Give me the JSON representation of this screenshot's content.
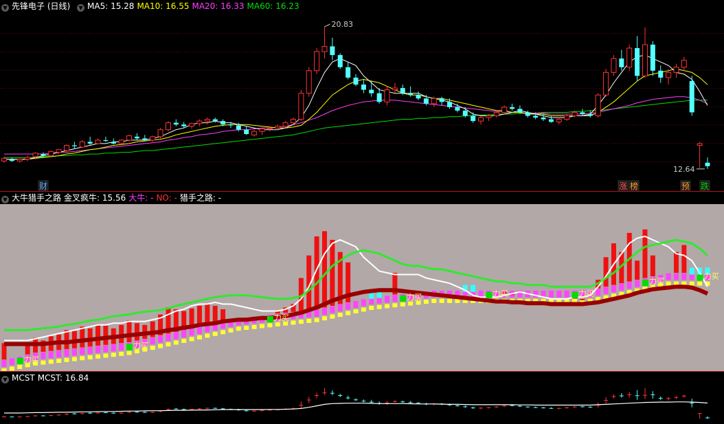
{
  "panels": {
    "main": {
      "title": "先锋电子 (日线)",
      "ma": [
        {
          "label": "MA5: 15.28",
          "color": "#ffffff"
        },
        {
          "label": "MA10: 16.55",
          "color": "#ffff00"
        },
        {
          "label": "MA20: 16.33",
          "color": "#ff40ff"
        },
        {
          "label": "MA60: 16.23",
          "color": "#00e000"
        }
      ],
      "high_label": "20.83",
      "low_label": "12.64",
      "markers": [
        {
          "text": "财",
          "color": "#5fa8ff"
        },
        {
          "text": "涨",
          "color": "#ff5050"
        },
        {
          "text": "榜",
          "color": "#ff9a2e"
        },
        {
          "text": "预",
          "color": "#ff9a2e"
        },
        {
          "text": "跌",
          "color": "#00d000"
        }
      ]
    },
    "indicator": {
      "title": "大牛猎手之路",
      "fields": [
        {
          "label": "金叉疯牛: 15.56",
          "color": "#ffffff"
        },
        {
          "label": "大牛: -",
          "color": "#ff40ff"
        },
        {
          "label": "NO: -",
          "color": "#ff3030"
        },
        {
          "label": "猎手之路: -",
          "color": "#ffffff"
        }
      ],
      "buy_label": "力买"
    },
    "mcst": {
      "title": "MCST",
      "field": "MCST: 16.84"
    }
  },
  "colors": {
    "up": "#ff3333",
    "down": "#54ffff",
    "bg_mid": "#b2a8a8"
  },
  "chart_data": [
    {
      "type": "candlestick",
      "title": "先锋电子 (日线)",
      "ylim": [
        12.0,
        21.5
      ],
      "high": 20.83,
      "low": 12.64,
      "candles": [
        [
          13.1,
          13.35,
          13.0,
          13.25
        ],
        [
          13.2,
          13.3,
          13.05,
          13.1
        ],
        [
          13.1,
          13.25,
          13.0,
          13.2
        ],
        [
          13.2,
          13.4,
          13.1,
          13.3
        ],
        [
          13.35,
          13.6,
          13.2,
          13.55
        ],
        [
          13.5,
          13.6,
          13.3,
          13.4
        ],
        [
          13.4,
          13.7,
          13.35,
          13.65
        ],
        [
          13.6,
          13.8,
          13.5,
          13.75
        ],
        [
          13.7,
          14.05,
          13.6,
          14.0
        ],
        [
          14.0,
          14.2,
          13.8,
          13.95
        ],
        [
          13.9,
          14.3,
          13.85,
          14.2
        ],
        [
          14.2,
          14.5,
          14.0,
          14.1
        ],
        [
          14.1,
          14.4,
          14.05,
          14.3
        ],
        [
          14.3,
          14.5,
          14.2,
          14.25
        ],
        [
          14.2,
          14.4,
          14.05,
          14.1
        ],
        [
          14.1,
          14.35,
          14.0,
          14.3
        ],
        [
          14.3,
          14.6,
          14.2,
          14.55
        ],
        [
          14.5,
          14.7,
          14.3,
          14.4
        ],
        [
          14.4,
          14.6,
          14.25,
          14.3
        ],
        [
          14.3,
          14.55,
          14.2,
          14.5
        ],
        [
          14.5,
          15.0,
          14.4,
          14.9
        ],
        [
          14.9,
          15.4,
          14.8,
          15.3
        ],
        [
          15.3,
          15.5,
          15.1,
          15.2
        ],
        [
          15.2,
          15.35,
          15.0,
          15.1
        ],
        [
          15.1,
          15.3,
          14.95,
          15.25
        ],
        [
          15.25,
          15.5,
          15.1,
          15.4
        ],
        [
          15.4,
          15.6,
          15.2,
          15.5
        ],
        [
          15.5,
          15.6,
          15.3,
          15.4
        ],
        [
          15.4,
          15.5,
          15.1,
          15.2
        ],
        [
          15.2,
          15.35,
          15.0,
          15.15
        ],
        [
          15.15,
          15.3,
          14.8,
          14.9
        ],
        [
          14.9,
          15.1,
          14.6,
          14.65
        ],
        [
          14.6,
          14.9,
          14.5,
          14.8
        ],
        [
          14.8,
          15.0,
          14.6,
          14.95
        ],
        [
          14.95,
          15.1,
          14.8,
          15.0
        ],
        [
          15.0,
          15.2,
          14.9,
          15.1
        ],
        [
          15.1,
          15.4,
          15.0,
          15.3
        ],
        [
          15.3,
          15.6,
          15.2,
          15.5
        ],
        [
          15.5,
          17.2,
          15.4,
          17.0
        ],
        [
          17.0,
          18.5,
          16.8,
          18.3
        ],
        [
          18.3,
          19.6,
          18.1,
          19.4
        ],
        [
          19.4,
          20.83,
          19.0,
          19.7
        ],
        [
          19.7,
          20.2,
          18.9,
          19.2
        ],
        [
          19.2,
          19.3,
          18.4,
          18.5
        ],
        [
          18.5,
          18.8,
          17.8,
          17.9
        ],
        [
          17.9,
          18.1,
          17.4,
          17.5
        ],
        [
          17.5,
          17.8,
          17.0,
          17.2
        ],
        [
          17.2,
          17.7,
          16.8,
          17.0
        ],
        [
          17.0,
          17.3,
          16.4,
          16.5
        ],
        [
          16.5,
          17.4,
          16.3,
          17.2
        ],
        [
          17.2,
          17.6,
          17.0,
          17.3
        ],
        [
          17.3,
          17.5,
          16.9,
          17.0
        ],
        [
          17.0,
          17.4,
          16.8,
          16.9
        ],
        [
          16.9,
          17.1,
          16.6,
          16.7
        ],
        [
          16.7,
          16.9,
          16.3,
          16.4
        ],
        [
          16.4,
          16.8,
          16.2,
          16.7
        ],
        [
          16.7,
          16.8,
          16.3,
          16.5
        ],
        [
          16.5,
          16.7,
          16.1,
          16.2
        ],
        [
          16.2,
          16.4,
          15.9,
          16.0
        ],
        [
          16.0,
          16.2,
          15.6,
          15.7
        ],
        [
          15.7,
          15.9,
          15.3,
          15.4
        ],
        [
          15.4,
          15.7,
          15.2,
          15.6
        ],
        [
          15.6,
          15.8,
          15.4,
          15.7
        ],
        [
          15.7,
          16.0,
          15.6,
          15.9
        ],
        [
          15.9,
          16.3,
          15.8,
          16.2
        ],
        [
          16.2,
          16.4,
          16.0,
          16.1
        ],
        [
          16.1,
          16.3,
          15.8,
          15.9
        ],
        [
          15.9,
          16.0,
          15.6,
          15.7
        ],
        [
          15.7,
          15.9,
          15.5,
          15.6
        ],
        [
          15.6,
          15.8,
          15.4,
          15.5
        ],
        [
          15.5,
          15.7,
          15.3,
          15.35
        ],
        [
          15.35,
          15.6,
          15.2,
          15.5
        ],
        [
          15.5,
          15.8,
          15.4,
          15.7
        ],
        [
          15.7,
          16.0,
          15.6,
          15.9
        ],
        [
          15.9,
          16.1,
          15.7,
          15.8
        ],
        [
          15.8,
          16.0,
          15.6,
          15.7
        ],
        [
          15.7,
          17.0,
          15.6,
          16.9
        ],
        [
          16.9,
          18.4,
          16.8,
          18.2
        ],
        [
          18.2,
          19.2,
          18.0,
          19.0
        ],
        [
          19.0,
          19.5,
          18.3,
          18.5
        ],
        [
          18.5,
          19.8,
          18.3,
          19.6
        ],
        [
          19.6,
          20.3,
          17.7,
          18.0
        ],
        [
          18.0,
          20.8,
          17.9,
          19.8
        ],
        [
          19.8,
          20.0,
          18.0,
          18.3
        ],
        [
          18.3,
          18.6,
          17.6,
          17.9
        ],
        [
          17.9,
          18.4,
          17.5,
          18.2
        ],
        [
          18.2,
          18.7,
          17.9,
          18.5
        ],
        [
          18.5,
          19.1,
          18.3,
          18.9
        ],
        [
          17.7,
          18.0,
          15.7,
          15.9
        ],
        [
          14.0,
          14.2,
          12.7,
          14.1
        ],
        [
          13.0,
          13.3,
          12.64,
          12.8
        ]
      ],
      "ma5": [
        13.2,
        13.2,
        13.2,
        13.2,
        13.3,
        13.4,
        13.5,
        13.6,
        13.7,
        13.8,
        13.9,
        14.0,
        14.1,
        14.1,
        14.2,
        14.2,
        14.3,
        14.3,
        14.3,
        14.4,
        14.5,
        14.7,
        14.9,
        15.0,
        15.2,
        15.3,
        15.3,
        15.4,
        15.3,
        15.3,
        15.2,
        15.1,
        15.0,
        14.9,
        14.9,
        14.9,
        15.0,
        15.2,
        15.6,
        16.3,
        17.3,
        18.2,
        18.8,
        19.0,
        18.8,
        18.6,
        18.0,
        17.6,
        17.2,
        17.1,
        17.0,
        17.0,
        17.0,
        17.0,
        16.8,
        16.7,
        16.6,
        16.5,
        16.3,
        16.1,
        15.8,
        15.7,
        15.7,
        15.7,
        15.8,
        15.9,
        16.0,
        15.9,
        15.8,
        15.7,
        15.6,
        15.6,
        15.6,
        15.7,
        15.7,
        15.8,
        16.3,
        16.9,
        17.6,
        18.2,
        18.8,
        19.1,
        19.2,
        19.0,
        18.8,
        18.6,
        18.2,
        18.1,
        17.8,
        17.1,
        16.3
      ],
      "ma10": [
        13.2,
        13.2,
        13.2,
        13.2,
        13.25,
        13.3,
        13.35,
        13.4,
        13.5,
        13.55,
        13.65,
        13.75,
        13.8,
        13.9,
        14.0,
        14.05,
        14.1,
        14.2,
        14.25,
        14.3,
        14.35,
        14.45,
        14.6,
        14.7,
        14.8,
        14.9,
        15.0,
        15.1,
        15.15,
        15.2,
        15.2,
        15.2,
        15.15,
        15.1,
        15.05,
        15.0,
        15.0,
        15.05,
        15.15,
        15.5,
        15.9,
        16.4,
        16.9,
        17.2,
        17.5,
        17.7,
        17.8,
        17.7,
        17.6,
        17.4,
        17.2,
        17.0,
        16.9,
        16.9,
        16.8,
        16.7,
        16.7,
        16.6,
        16.5,
        16.4,
        16.3,
        16.2,
        16.1,
        16.0,
        16.0,
        15.9,
        15.9,
        15.8,
        15.8,
        15.8,
        15.7,
        15.7,
        15.7,
        15.7,
        15.7,
        15.7,
        15.9,
        16.2,
        16.5,
        16.9,
        17.3,
        17.7,
        18.0,
        18.1,
        18.2,
        18.3,
        18.4,
        18.3,
        18.2,
        17.9,
        17.5
      ],
      "ma20": [
        13.5,
        13.5,
        13.5,
        13.5,
        13.5,
        13.5,
        13.55,
        13.6,
        13.6,
        13.65,
        13.7,
        13.75,
        13.8,
        13.85,
        13.9,
        13.95,
        14.0,
        14.05,
        14.1,
        14.15,
        14.2,
        14.3,
        14.35,
        14.45,
        14.5,
        14.6,
        14.65,
        14.7,
        14.8,
        14.85,
        14.9,
        14.9,
        14.95,
        15.0,
        15.0,
        15.05,
        15.1,
        15.2,
        15.3,
        15.45,
        15.6,
        15.8,
        16.0,
        16.15,
        16.3,
        16.4,
        16.5,
        16.55,
        16.6,
        16.6,
        16.6,
        16.55,
        16.5,
        16.45,
        16.4,
        16.35,
        16.3,
        16.25,
        16.2,
        16.15,
        16.1,
        16.05,
        16.0,
        15.95,
        15.95,
        15.9,
        15.9,
        15.85,
        15.85,
        15.85,
        15.8,
        15.8,
        15.8,
        15.8,
        15.8,
        15.85,
        15.9,
        16.0,
        16.1,
        16.2,
        16.3,
        16.45,
        16.55,
        16.65,
        16.7,
        16.75,
        16.8,
        16.8,
        16.75,
        16.6,
        16.4
      ],
      "ma60": [
        13.3,
        13.3,
        13.3,
        13.3,
        13.3,
        13.35,
        13.35,
        13.4,
        13.4,
        13.45,
        13.45,
        13.5,
        13.5,
        13.55,
        13.55,
        13.6,
        13.6,
        13.65,
        13.7,
        13.7,
        13.75,
        13.8,
        13.85,
        13.9,
        13.95,
        14.0,
        14.05,
        14.1,
        14.15,
        14.2,
        14.25,
        14.3,
        14.35,
        14.4,
        14.45,
        14.5,
        14.55,
        14.6,
        14.7,
        14.8,
        14.9,
        15.0,
        15.05,
        15.1,
        15.15,
        15.2,
        15.25,
        15.3,
        15.35,
        15.4,
        15.45,
        15.5,
        15.5,
        15.55,
        15.55,
        15.6,
        15.6,
        15.65,
        15.65,
        15.7,
        15.7,
        15.75,
        15.75,
        15.8,
        15.8,
        15.8,
        15.85,
        15.85,
        15.85,
        15.9,
        15.9,
        15.9,
        15.9,
        15.95,
        15.95,
        16.0,
        16.0,
        16.05,
        16.1,
        16.15,
        16.2,
        16.25,
        16.3,
        16.35,
        16.4,
        16.45,
        16.5,
        16.55,
        16.6,
        16.6,
        16.6
      ]
    },
    {
      "type": "area",
      "title": "大牛猎手之路",
      "ylim": [
        12.0,
        21.5
      ],
      "bars": [
        13.6,
        13.7,
        13.8,
        13.9,
        14.0,
        14.05,
        14.1,
        14.15,
        14.2,
        14.25,
        14.3,
        14.35,
        14.4,
        14.45,
        14.5,
        14.55,
        14.6,
        14.7,
        14.8,
        14.9,
        15.0,
        15.1,
        15.2,
        15.3,
        15.4,
        15.5,
        15.6,
        15.7,
        15.8,
        15.9,
        16.0,
        16.05,
        16.1,
        16.15,
        16.2,
        16.25,
        16.3,
        16.35,
        16.4,
        16.45,
        16.5,
        16.6,
        16.7,
        16.8,
        16.9,
        17.0,
        17.1,
        17.2,
        17.25,
        17.3,
        17.35,
        17.4,
        17.45,
        17.5,
        17.55,
        17.6,
        17.6,
        17.6,
        17.6,
        17.6,
        17.6,
        17.6,
        17.6,
        17.6,
        17.6,
        17.6,
        17.6,
        17.6,
        17.6,
        17.6,
        17.6,
        17.6,
        17.6,
        17.6,
        17.6,
        17.6,
        17.7,
        17.8,
        17.9,
        18.0,
        18.1,
        18.2,
        18.3,
        18.4,
        18.5,
        18.6,
        18.6,
        18.6,
        18.6,
        18.6,
        18.6
      ],
      "buy_points": [
        2,
        16,
        34,
        51,
        62,
        73,
        82,
        89
      ]
    },
    {
      "type": "line",
      "title": "MCST",
      "value": 16.84,
      "ylim": [
        12.0,
        21.5
      ],
      "mcst": [
        14.2,
        14.2,
        14.2,
        14.25,
        14.3,
        14.3,
        14.35,
        14.4,
        14.4,
        14.45,
        14.5,
        14.5,
        14.55,
        14.6,
        14.6,
        14.65,
        14.7,
        14.7,
        14.75,
        14.8,
        14.8,
        14.85,
        14.9,
        14.9,
        14.95,
        15.0,
        15.0,
        15.05,
        15.1,
        15.1,
        15.1,
        15.1,
        15.1,
        15.1,
        15.15,
        15.15,
        15.2,
        15.25,
        15.4,
        15.7,
        16.1,
        16.5,
        16.7,
        16.75,
        16.8,
        16.8,
        16.8,
        16.75,
        16.7,
        16.7,
        16.7,
        16.7,
        16.65,
        16.6,
        16.6,
        16.6,
        16.55,
        16.5,
        16.5,
        16.45,
        16.4,
        16.4,
        16.4,
        16.4,
        16.4,
        16.4,
        16.35,
        16.35,
        16.3,
        16.3,
        16.3,
        16.3,
        16.3,
        16.3,
        16.3,
        16.3,
        16.4,
        16.5,
        16.6,
        16.7,
        16.8,
        16.9,
        17.0,
        17.05,
        17.1,
        17.1,
        17.15,
        17.15,
        17.1,
        17.0,
        16.84
      ]
    }
  ]
}
